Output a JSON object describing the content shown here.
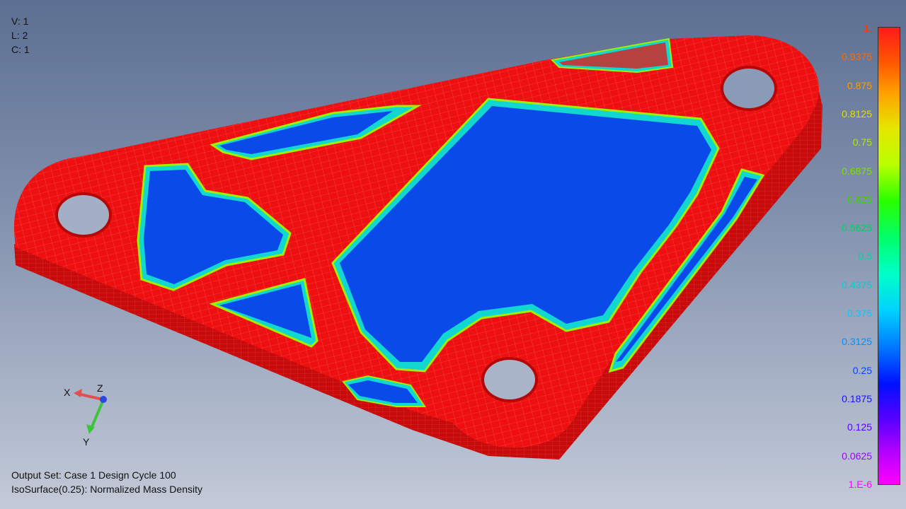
{
  "viewport": {
    "info": [
      "V: 1",
      "L: 2",
      "C: 1"
    ],
    "output_set": "Output Set: Case 1 Design Cycle 100",
    "contour": "IsoSurface(0.25): Normalized Mass Density"
  },
  "triad": {
    "x": "X",
    "y": "Y",
    "z": "Z"
  },
  "legend": {
    "labels": [
      "1.",
      "0.9375",
      "0.875",
      "0.8125",
      "0.75",
      "0.6875",
      "0.625",
      "0.5625",
      "0.5",
      "0.4375",
      "0.375",
      "0.3125",
      "0.25",
      "0.1875",
      "0.125",
      "0.0625",
      "1.E-6"
    ],
    "label_colors": [
      "#ff3300",
      "#ff6a00",
      "#ff9c00",
      "#e0e000",
      "#b6e800",
      "#80e000",
      "#38d400",
      "#00d060",
      "#00d4a0",
      "#00d0d0",
      "#00c8ff",
      "#0090ff",
      "#0044ff",
      "#1a10ff",
      "#5a00ff",
      "#a000ff",
      "#ff00ff"
    ]
  },
  "model": {
    "colors": {
      "solid": "#ee1010",
      "edge": "#c80a0a",
      "void": "#0a4ae8",
      "void_dark": "#0636b8",
      "transition": "#12d6d0",
      "mesh": "#ff9a9a"
    }
  }
}
